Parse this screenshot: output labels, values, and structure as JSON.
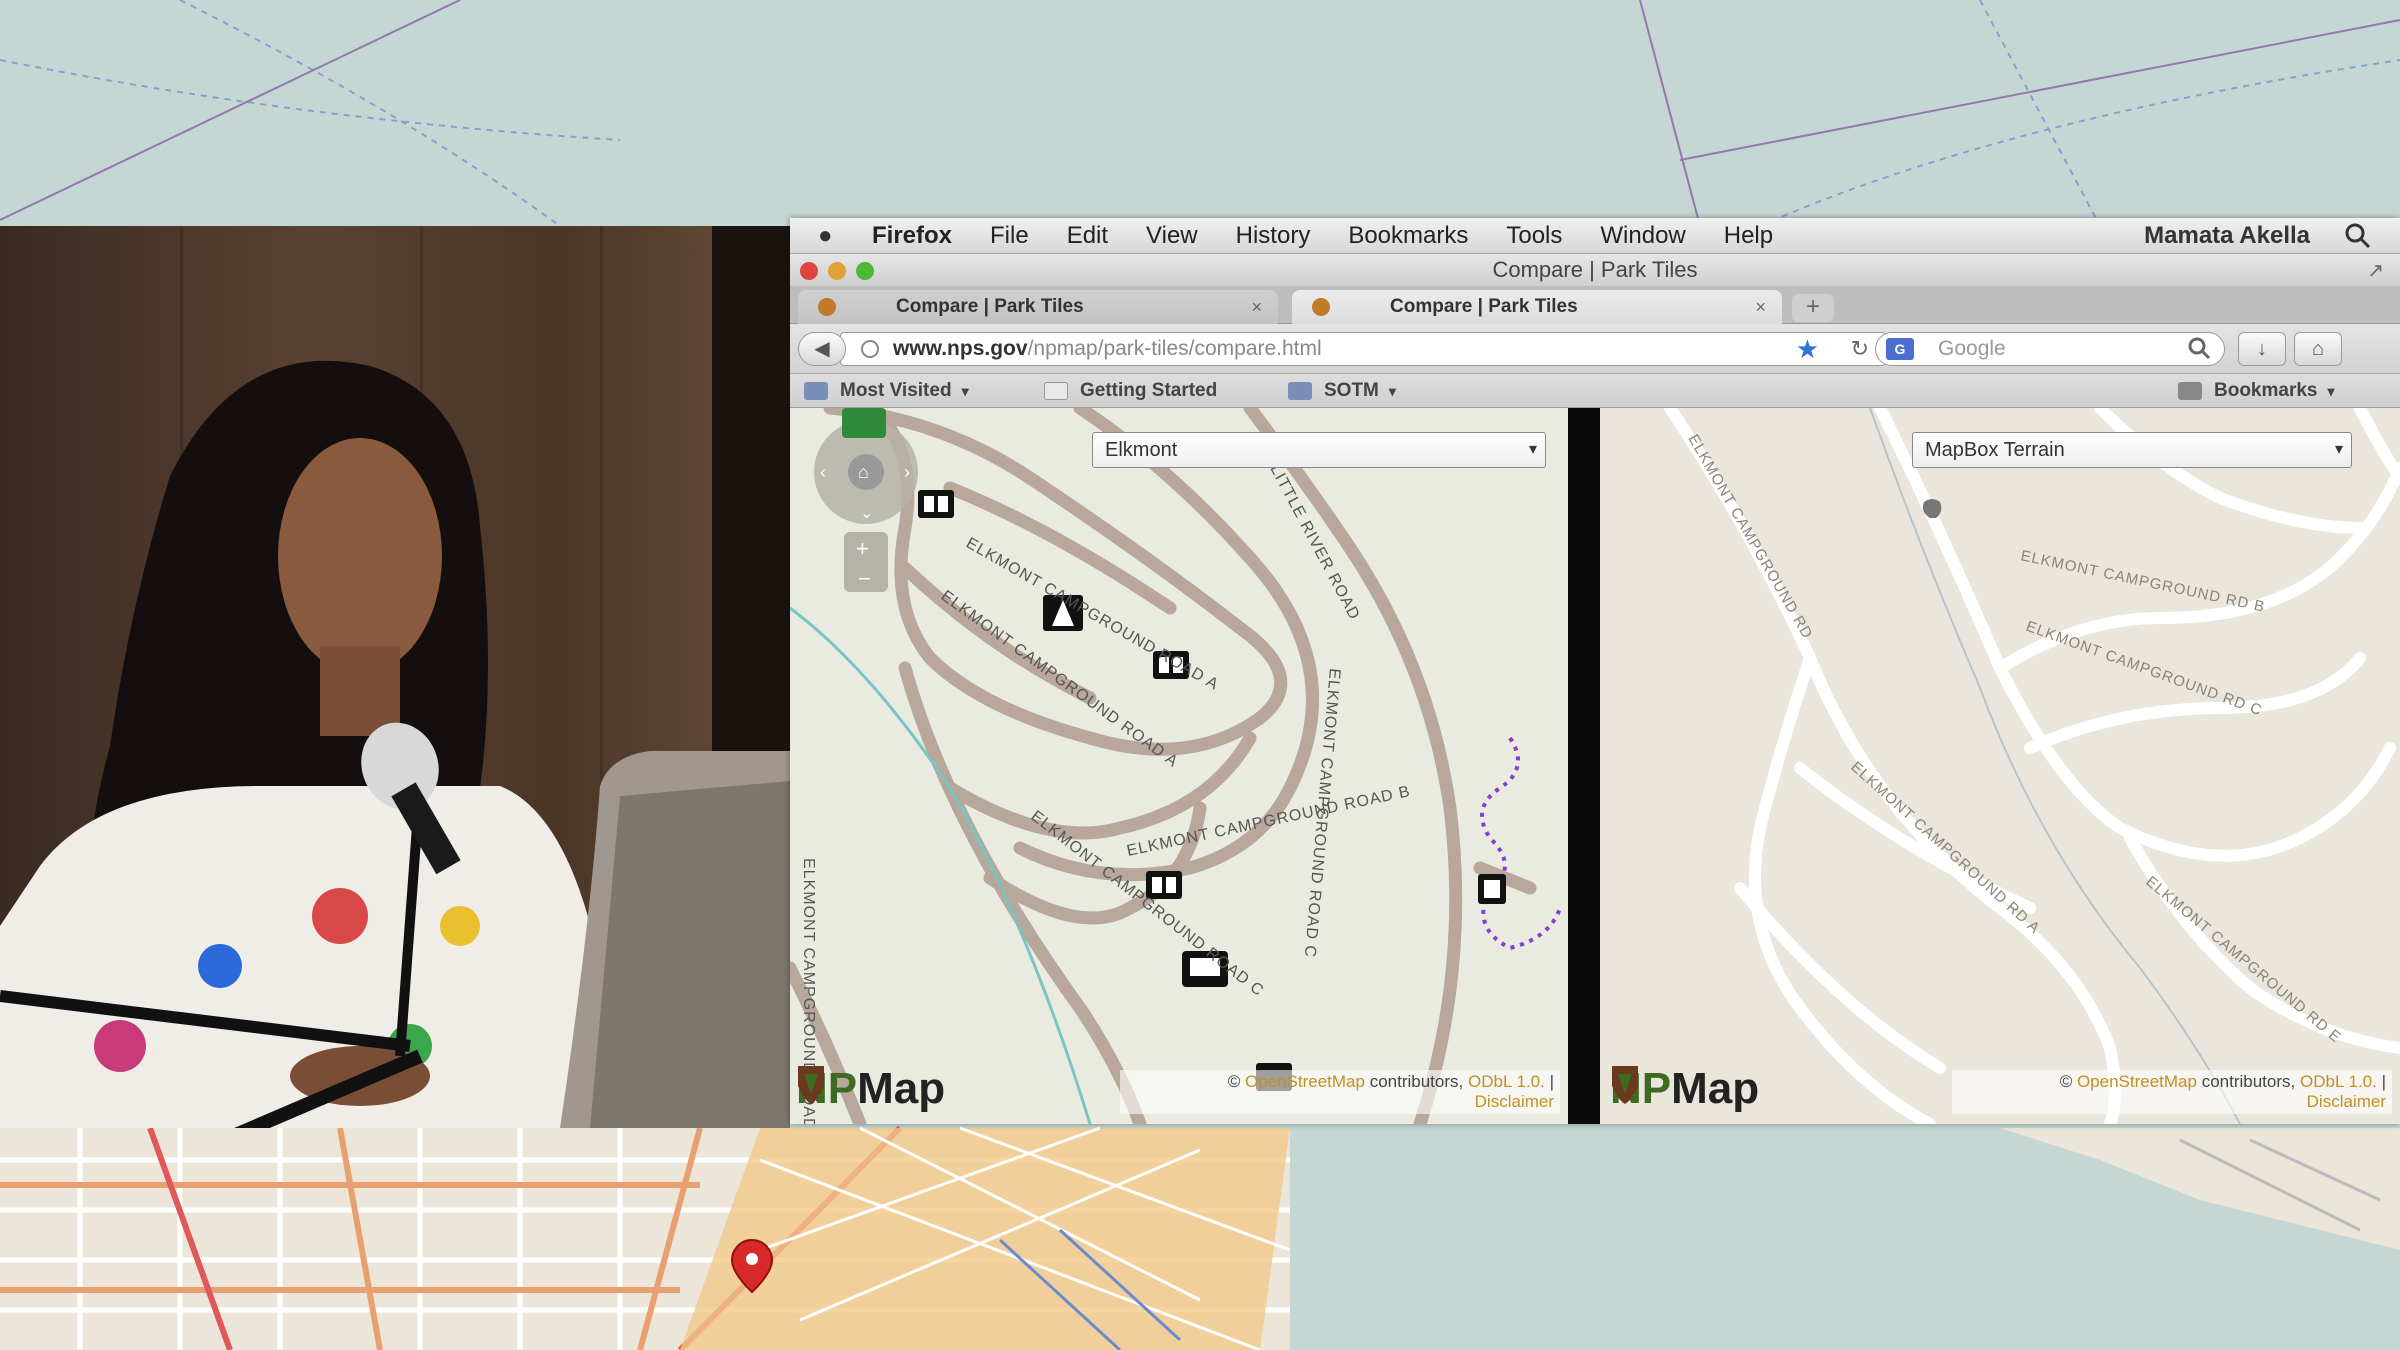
{
  "menubar": {
    "app": "Firefox",
    "items": [
      "File",
      "Edit",
      "View",
      "History",
      "Bookmarks",
      "Tools",
      "Window",
      "Help"
    ],
    "user": "Mamata Akella"
  },
  "window": {
    "title": "Compare | Park Tiles"
  },
  "tabs": [
    {
      "label": "Compare | Park Tiles",
      "close": "×"
    },
    {
      "label": "Compare | Park Tiles",
      "close": "×"
    }
  ],
  "newtab_label": "+",
  "navbar": {
    "url_host": "www.nps.gov",
    "url_path": "/npmap/park-tiles/compare.html",
    "search_placeholder": "Google"
  },
  "bookmarks": {
    "most_visited": "Most Visited",
    "getting_started": "Getting Started",
    "sotm": "SOTM",
    "bookmarks_menu": "Bookmarks"
  },
  "left_map": {
    "layer": "Elkmont",
    "labels": [
      "ELKMONT CAMPGROUND ROAD A",
      "ELKMONT CAMPGROUND ROAD A",
      "ELKMONT CAMPGROUND ROAD B",
      "ELKMONT CAMPGROUND ROAD C",
      "ELKMONT CAMPGROUND ROAD C",
      "LITTLE RIVER ROAD",
      "ELKMONT CAMPGROUND ROAD D"
    ]
  },
  "right_map": {
    "layer": "MapBox Terrain",
    "labels": [
      "ELKMONT CAMPGROUND RD B",
      "ELKMONT CAMPGROUND RD C",
      "ELKMONT CAMPGROUND RD A",
      "ELKMONT CAMPGROUND RD E",
      "ELKMONT CAMPGROUND RD"
    ]
  },
  "brand": {
    "np": "NP",
    "map": "Map"
  },
  "attribution": {
    "prefix": "©",
    "osm": "OpenStreetMap",
    "contrib": "contributors,",
    "odbl": "ODbL 1.0.",
    "sep": "|",
    "disclaimer": "Disclaimer"
  },
  "colors": {
    "park_green": "#3e6b22",
    "road_brown": "#b8a79a",
    "trail_purple": "#8a3bd6",
    "link_gold": "#c09020",
    "star_blue": "#2c74d8"
  }
}
